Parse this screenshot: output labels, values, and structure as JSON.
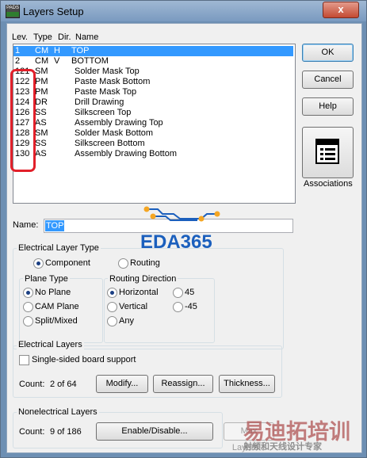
{
  "window": {
    "title": "Layers Setup",
    "app_icon_label": "PADS",
    "close_glyph": "x"
  },
  "columns": {
    "lev": "Lev.",
    "type": "Type",
    "dir": "Dir.",
    "name": "Name"
  },
  "layers": [
    {
      "lev": "1",
      "type": "CM",
      "dir": "H",
      "name": "TOP",
      "selected": true
    },
    {
      "lev": "2",
      "type": "CM",
      "dir": "V",
      "name": "BOTTOM"
    },
    {
      "lev": "121",
      "type": "SM",
      "dir": "",
      "name": "Solder Mask Top"
    },
    {
      "lev": "122",
      "type": "PM",
      "dir": "",
      "name": "Paste Mask Bottom"
    },
    {
      "lev": "123",
      "type": "PM",
      "dir": "",
      "name": "Paste Mask Top"
    },
    {
      "lev": "124",
      "type": "DR",
      "dir": "",
      "name": "Drill Drawing"
    },
    {
      "lev": "126",
      "type": "SS",
      "dir": "",
      "name": "Silkscreen Top"
    },
    {
      "lev": "127",
      "type": "AS",
      "dir": "",
      "name": "Assembly Drawing Top"
    },
    {
      "lev": "128",
      "type": "SM",
      "dir": "",
      "name": "Solder Mask Bottom"
    },
    {
      "lev": "129",
      "type": "SS",
      "dir": "",
      "name": "Silkscreen Bottom"
    },
    {
      "lev": "130",
      "type": "AS",
      "dir": "",
      "name": "Assembly Drawing Bottom"
    }
  ],
  "buttons": {
    "ok": "OK",
    "cancel": "Cancel",
    "help": "Help",
    "associations": "Associations",
    "modify": "Modify...",
    "reassign": "Reassign...",
    "thickness": "Thickness...",
    "enable_disable": "Enable/Disable...",
    "max_layers": "Max Layers..."
  },
  "name_field": {
    "label": "Name:",
    "value": "TOP"
  },
  "electrical_layer_type": {
    "title": "Electrical  Layer Type",
    "component": "Component",
    "routing": "Routing",
    "selected": "component"
  },
  "plane_type": {
    "title": "Plane Type",
    "no_plane": "No Plane",
    "cam_plane": "CAM Plane",
    "split_mixed": "Split/Mixed",
    "selected": "no_plane"
  },
  "routing_direction": {
    "title": "Routing Direction",
    "horizontal": "Horizontal",
    "vertical": "Vertical",
    "any": "Any",
    "deg45": "45",
    "deg_minus45": "-45",
    "selected": "horizontal"
  },
  "electrical_layers": {
    "title": "Electrical Layers",
    "single_sided": "Single-sided board support",
    "single_sided_checked": false,
    "count_label": "Count:",
    "count_value": "2 of 64"
  },
  "nonelectrical_layers": {
    "title": "Nonelectrical Layers",
    "count_label": "Count:",
    "count_value": "9 of 186"
  },
  "watermarks": {
    "eda": "EDA365",
    "cn_logo": "易迪拓培训",
    "cn_sub": "射频和天线设计专家"
  },
  "colors": {
    "selection": "#3399ff",
    "highlight_box": "#e2202a",
    "eda_blue": "#1b5fbd"
  }
}
